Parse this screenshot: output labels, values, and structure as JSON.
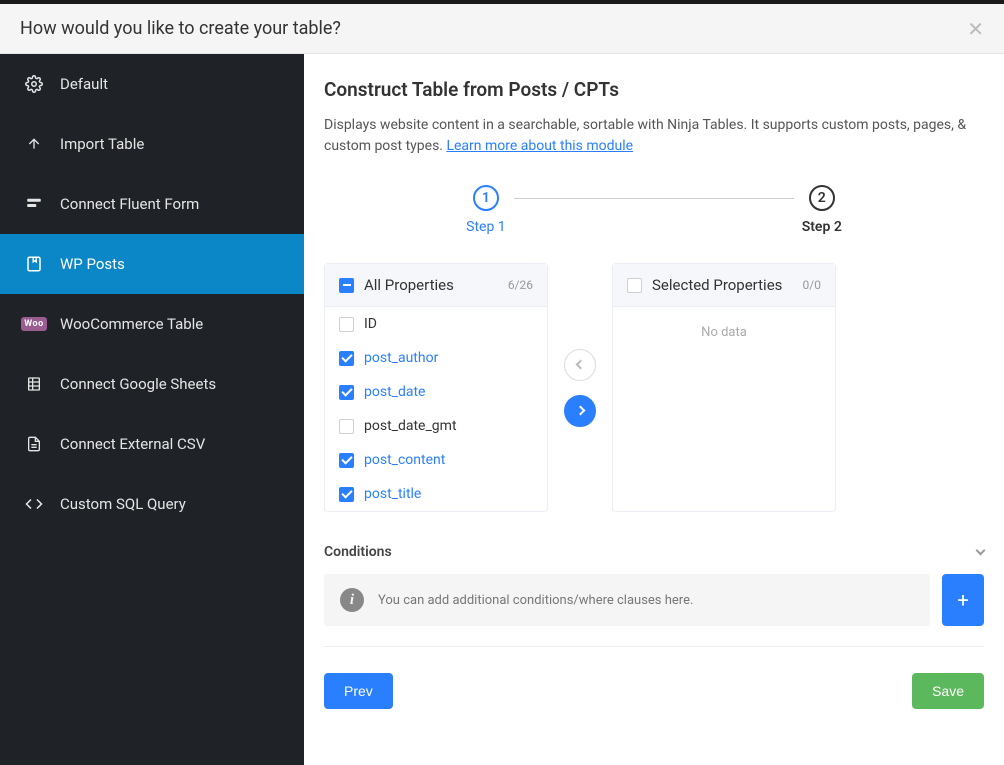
{
  "header": {
    "title": "How would you like to create your table?"
  },
  "sidebar": {
    "items": [
      {
        "label": "Default"
      },
      {
        "label": "Import Table"
      },
      {
        "label": "Connect Fluent Form"
      },
      {
        "label": "WP Posts"
      },
      {
        "label": "WooCommerce Table"
      },
      {
        "label": "Connect Google Sheets"
      },
      {
        "label": "Connect External CSV"
      },
      {
        "label": "Custom SQL Query"
      }
    ]
  },
  "main": {
    "title": "Construct Table from Posts / CPTs",
    "description": "Displays website content in a searchable, sortable with Ninja Tables. It supports custom posts, pages, & custom post types. ",
    "learn_more": "Learn more about this module",
    "steps": [
      {
        "num": "1",
        "label": "Step 1"
      },
      {
        "num": "2",
        "label": "Step 2"
      }
    ],
    "left_panel": {
      "title": "All Properties",
      "count": "6/26"
    },
    "right_panel": {
      "title": "Selected Properties",
      "count": "0/0",
      "nodata": "No data"
    },
    "properties": [
      {
        "label": "ID",
        "checked": false
      },
      {
        "label": "post_author",
        "checked": true
      },
      {
        "label": "post_date",
        "checked": true
      },
      {
        "label": "post_date_gmt",
        "checked": false
      },
      {
        "label": "post_content",
        "checked": true
      },
      {
        "label": "post_title",
        "checked": true
      }
    ],
    "conditions": {
      "heading": "Conditions",
      "message": "You can add additional conditions/where clauses here."
    },
    "buttons": {
      "prev": "Prev",
      "save": "Save"
    }
  }
}
